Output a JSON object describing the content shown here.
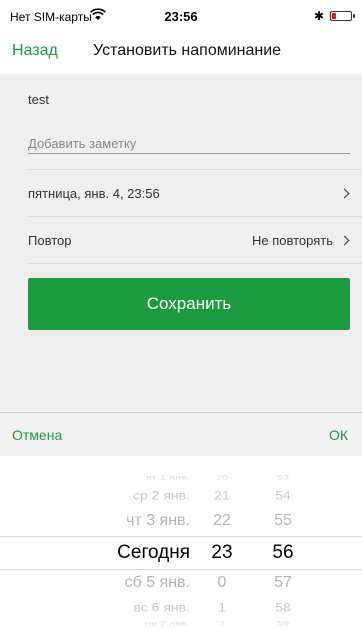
{
  "status_bar": {
    "carrier": "Нет SIM-карты",
    "time": "23:56",
    "bluetooth": "✱",
    "wifi_icon": "wifi-icon",
    "battery_icon": "battery-low-icon",
    "battery_color": "#e02020"
  },
  "nav": {
    "back_label": "Назад",
    "title": "Установить напоминание"
  },
  "form": {
    "title_value": "test",
    "note_placeholder": "Добавить заметку",
    "note_value": "",
    "date_value": "пятница, янв. 4, 23:56",
    "repeat_label": "Повтор",
    "repeat_value": "Не повторять",
    "save_label": "Сохранить"
  },
  "picker_toolbar": {
    "cancel_label": "Отмена",
    "ok_label": "ОК"
  },
  "picker": {
    "days": [
      "вт 1 янв.",
      "ср 2 янв.",
      "чт 3 янв.",
      "Сегодня",
      "сб 5 янв.",
      "вс 6 янв.",
      "пн 7 янв."
    ],
    "hours": [
      "20",
      "21",
      "22",
      "23",
      "0",
      "1",
      "2"
    ],
    "minutes": [
      "53",
      "54",
      "55",
      "56",
      "57",
      "58",
      "59"
    ],
    "selected_day": "Сегодня",
    "selected_hour": "23",
    "selected_minute": "56"
  },
  "colors": {
    "accent": "#1a9c3e",
    "content_bg": "#efefef"
  }
}
